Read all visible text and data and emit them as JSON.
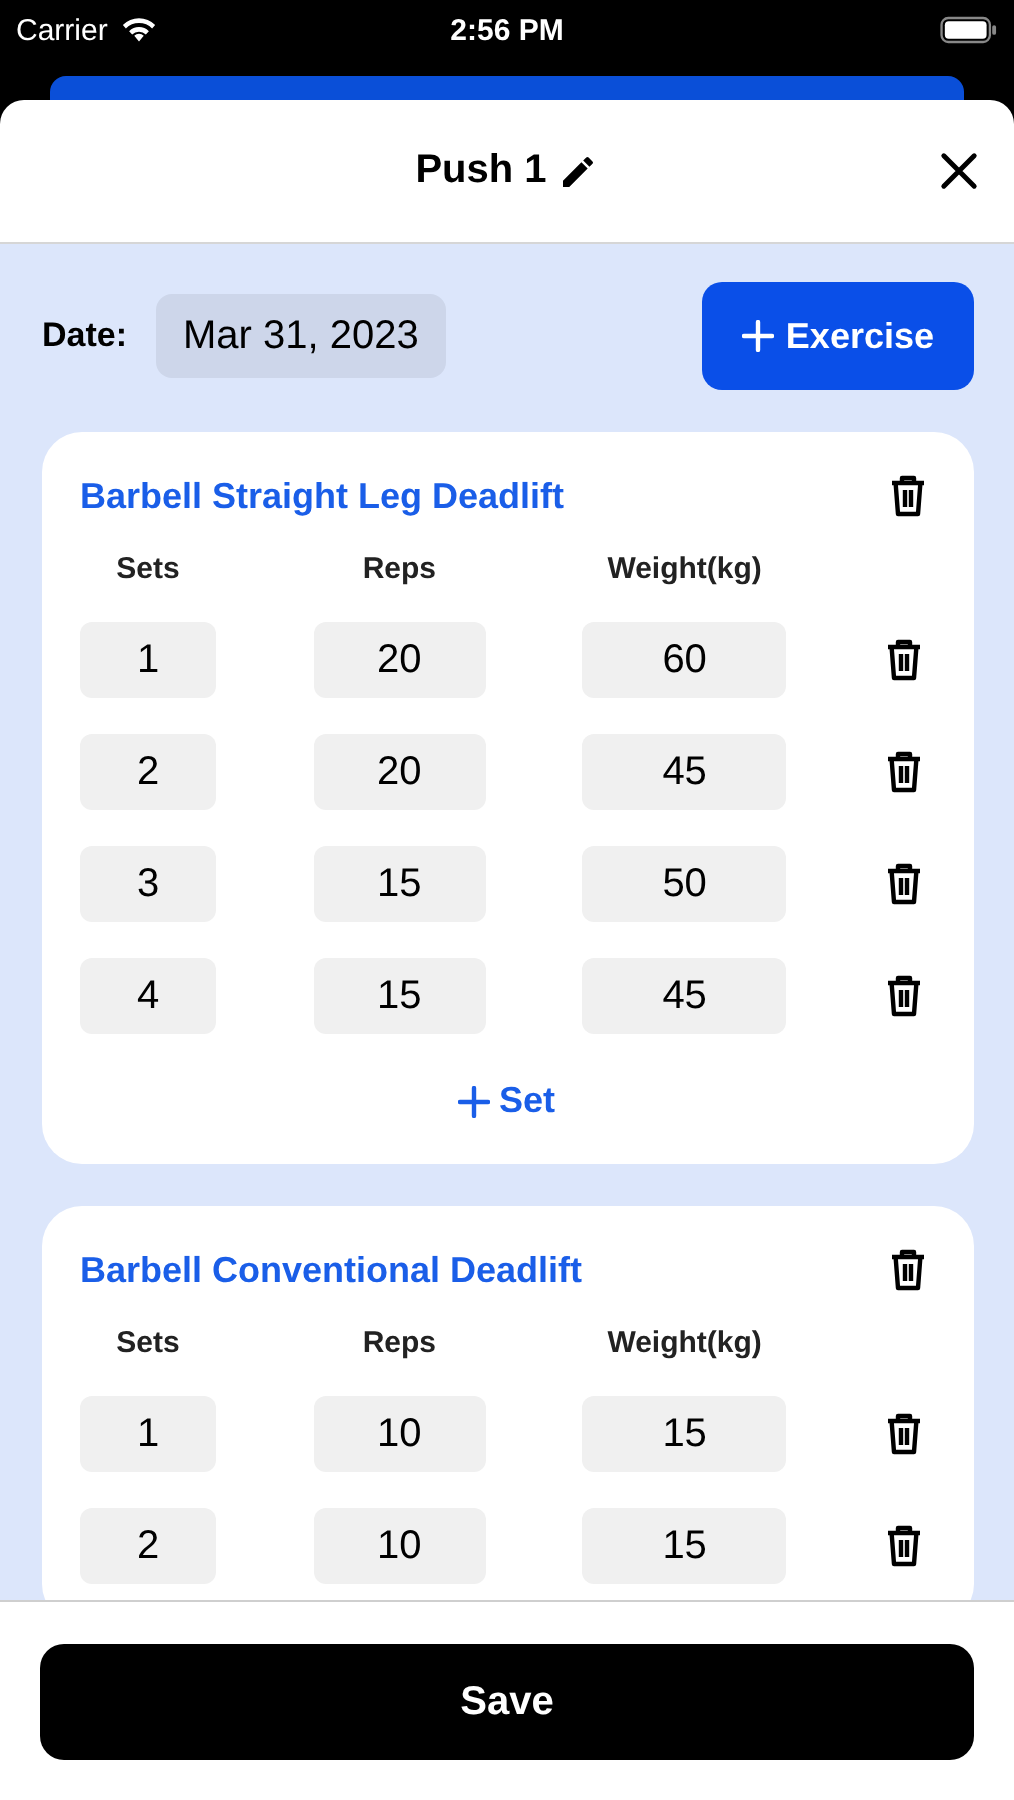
{
  "status_bar": {
    "carrier": "Carrier",
    "time": "2:56 PM"
  },
  "header": {
    "title": "Push 1"
  },
  "date": {
    "label": "Date:",
    "value": "Mar 31, 2023"
  },
  "add_exercise_button": "Exercise",
  "exercises": [
    {
      "name": "Barbell Straight Leg Deadlift",
      "add_set_label": "Set",
      "columns": [
        "Sets",
        "Reps",
        "Weight(kg)"
      ],
      "sets": [
        {
          "set": "1",
          "reps": "20",
          "weight": "60"
        },
        {
          "set": "2",
          "reps": "20",
          "weight": "45"
        },
        {
          "set": "3",
          "reps": "15",
          "weight": "50"
        },
        {
          "set": "4",
          "reps": "15",
          "weight": "45"
        }
      ]
    },
    {
      "name": "Barbell Conventional Deadlift",
      "columns": [
        "Sets",
        "Reps",
        "Weight(kg)"
      ],
      "sets": [
        {
          "set": "1",
          "reps": "10",
          "weight": "15"
        },
        {
          "set": "2",
          "reps": "10",
          "weight": "15"
        }
      ]
    }
  ],
  "save_button": "Save"
}
